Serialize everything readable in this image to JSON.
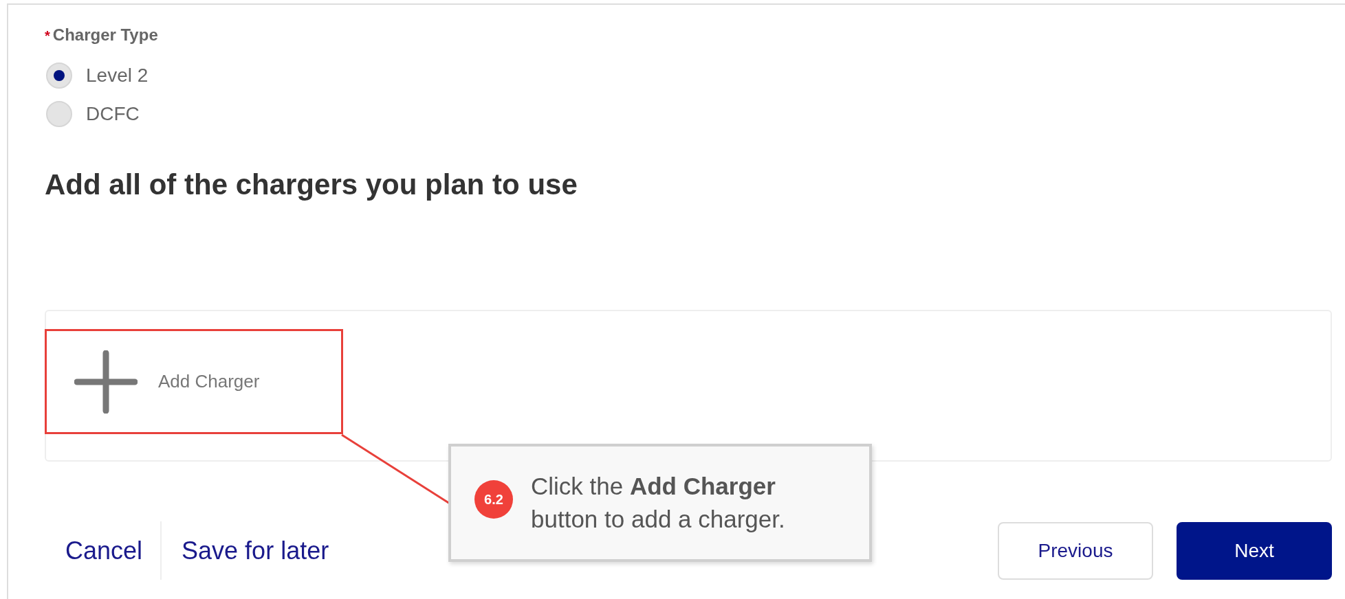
{
  "form": {
    "field": {
      "required_mark": "*",
      "label": "Charger Type",
      "options": [
        {
          "label": "Level 2",
          "selected": true
        },
        {
          "label": "DCFC",
          "selected": false
        }
      ]
    },
    "heading": "Add all of the chargers you plan to use",
    "add_button": {
      "label": "Add Charger",
      "highlighted": true
    }
  },
  "callout": {
    "step": "6.2",
    "text": "Click the **Add Charger** button to add a charger."
  },
  "footer": {
    "links": [
      "Cancel",
      "Save for later"
    ],
    "buttons": [
      {
        "label": "Previous",
        "kind": "secondary"
      },
      {
        "label": "Next",
        "kind": "primary"
      }
    ]
  }
}
